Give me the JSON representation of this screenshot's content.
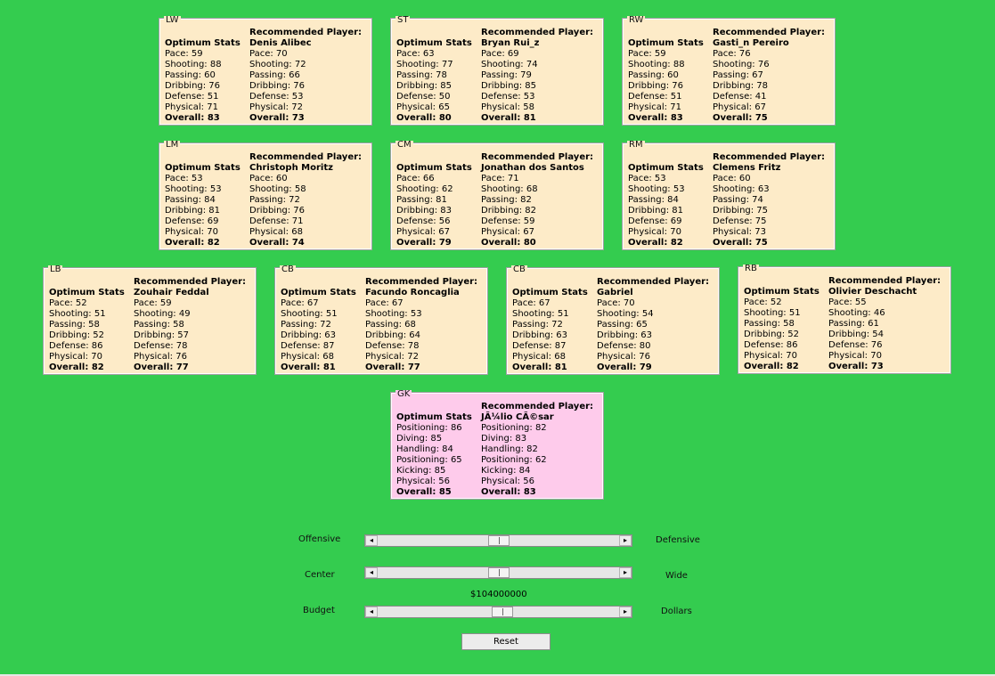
{
  "labels": {
    "optimum": "Optimum Stats",
    "recommended": "Recommended Player:"
  },
  "positions": {
    "LW": {
      "code": "LW",
      "player": "Denis Alibec",
      "opt": [
        "Pace: 59",
        "Shooting: 88",
        "Passing: 60",
        "Dribbing: 76",
        "Defense: 51",
        "Physical: 71",
        "Overall: 83"
      ],
      "rec": [
        "Pace: 70",
        "Shooting: 72",
        "Passing: 66",
        "Dribbing: 76",
        "Defense: 53",
        "Physical: 72",
        "Overall: 73"
      ]
    },
    "ST": {
      "code": "ST",
      "player": "Bryan Rui_z",
      "opt": [
        "Pace: 63",
        "Shooting: 77",
        "Passing: 78",
        "Dribbing: 85",
        "Defense: 50",
        "Physical: 65",
        "Overall: 80"
      ],
      "rec": [
        "Pace: 69",
        "Shooting: 74",
        "Passing: 79",
        "Dribbing: 85",
        "Defense: 53",
        "Physical: 58",
        "Overall: 81"
      ]
    },
    "RW": {
      "code": "RW",
      "player": "Gasti_n Pereiro",
      "opt": [
        "Pace: 59",
        "Shooting: 88",
        "Passing: 60",
        "Dribbing: 76",
        "Defense: 51",
        "Physical: 71",
        "Overall: 83"
      ],
      "rec": [
        "Pace: 76",
        "Shooting: 76",
        "Passing: 67",
        "Dribbing: 78",
        "Defense: 41",
        "Physical: 67",
        "Overall: 75"
      ]
    },
    "LM": {
      "code": "LM",
      "player": "Christoph Moritz",
      "opt": [
        "Pace: 53",
        "Shooting: 53",
        "Passing: 84",
        "Dribbing: 81",
        "Defense: 69",
        "Physical: 70",
        "Overall: 82"
      ],
      "rec": [
        "Pace: 60",
        "Shooting: 58",
        "Passing: 72",
        "Dribbing: 76",
        "Defense: 71",
        "Physical: 68",
        "Overall: 74"
      ]
    },
    "CM": {
      "code": "CM",
      "player": "Jonathan dos Santos",
      "opt": [
        "Pace: 66",
        "Shooting: 62",
        "Passing: 81",
        "Dribbing: 83",
        "Defense: 56",
        "Physical: 67",
        "Overall: 79"
      ],
      "rec": [
        "Pace: 71",
        "Shooting: 68",
        "Passing: 82",
        "Dribbing: 82",
        "Defense: 59",
        "Physical: 67",
        "Overall: 80"
      ]
    },
    "RM": {
      "code": "RM",
      "player": "Clemens Fritz",
      "opt": [
        "Pace: 53",
        "Shooting: 53",
        "Passing: 84",
        "Dribbing: 81",
        "Defense: 69",
        "Physical: 70",
        "Overall: 82"
      ],
      "rec": [
        "Pace: 60",
        "Shooting: 63",
        "Passing: 74",
        "Dribbing: 75",
        "Defense: 75",
        "Physical: 73",
        "Overall: 75"
      ]
    },
    "LB": {
      "code": "LB",
      "player": "Zouhair Feddal",
      "opt": [
        "Pace: 52",
        "Shooting: 51",
        "Passing: 58",
        "Dribbing: 52",
        "Defense: 86",
        "Physical: 70",
        "Overall: 82"
      ],
      "rec": [
        "Pace: 59",
        "Shooting: 49",
        "Passing: 58",
        "Dribbing: 57",
        "Defense: 78",
        "Physical: 76",
        "Overall: 77"
      ]
    },
    "CB1": {
      "code": "CB",
      "player": "Facundo Roncaglia",
      "opt": [
        "Pace: 67",
        "Shooting: 51",
        "Passing: 72",
        "Dribbing: 63",
        "Defense: 87",
        "Physical: 68",
        "Overall: 81"
      ],
      "rec": [
        "Pace: 67",
        "Shooting: 53",
        "Passing: 68",
        "Dribbing: 64",
        "Defense: 78",
        "Physical: 72",
        "Overall: 77"
      ]
    },
    "CB2": {
      "code": "CB",
      "player": "Gabriel",
      "opt": [
        "Pace: 67",
        "Shooting: 51",
        "Passing: 72",
        "Dribbing: 63",
        "Defense: 87",
        "Physical: 68",
        "Overall: 81"
      ],
      "rec": [
        "Pace: 70",
        "Shooting: 54",
        "Passing: 65",
        "Dribbing: 63",
        "Defense: 80",
        "Physical: 76",
        "Overall: 79"
      ]
    },
    "RB": {
      "code": "RB",
      "player": "Olivier Deschacht",
      "opt": [
        "Pace: 52",
        "Shooting: 51",
        "Passing: 58",
        "Dribbing: 52",
        "Defense: 86",
        "Physical: 70",
        "Overall: 82"
      ],
      "rec": [
        "Pace: 55",
        "Shooting: 46",
        "Passing: 61",
        "Dribbing: 54",
        "Defense: 76",
        "Physical: 70",
        "Overall: 73"
      ]
    },
    "GK": {
      "code": "GK",
      "player": "JÃ¼lio CÃ©sar",
      "opt": [
        "Positioning: 86",
        "Diving: 85",
        "Handling: 84",
        "Positioning: 65",
        "Kicking: 85",
        "Physical: 56",
        "Overall: 85"
      ],
      "rec": [
        "Positioning: 82",
        "Diving: 83",
        "Handling: 82",
        "Positioning: 62",
        "Kicking: 84",
        "Physical: 56",
        "Overall: 83"
      ]
    }
  },
  "sliders": {
    "style": {
      "left_label": "Offensive",
      "right_label": "Defensive",
      "value": 0.5
    },
    "width": {
      "left_label": "Center",
      "right_label": "Wide",
      "value": 0.5
    },
    "budget": {
      "left_label": "Budget",
      "right_label": "Dollars",
      "value": 0.52,
      "display": "$104000000"
    }
  },
  "reset_label": "Reset",
  "colors": {
    "background": "#34cc4f",
    "outfield_panel": "#fdebc8",
    "gk_panel": "#fecbeb"
  }
}
